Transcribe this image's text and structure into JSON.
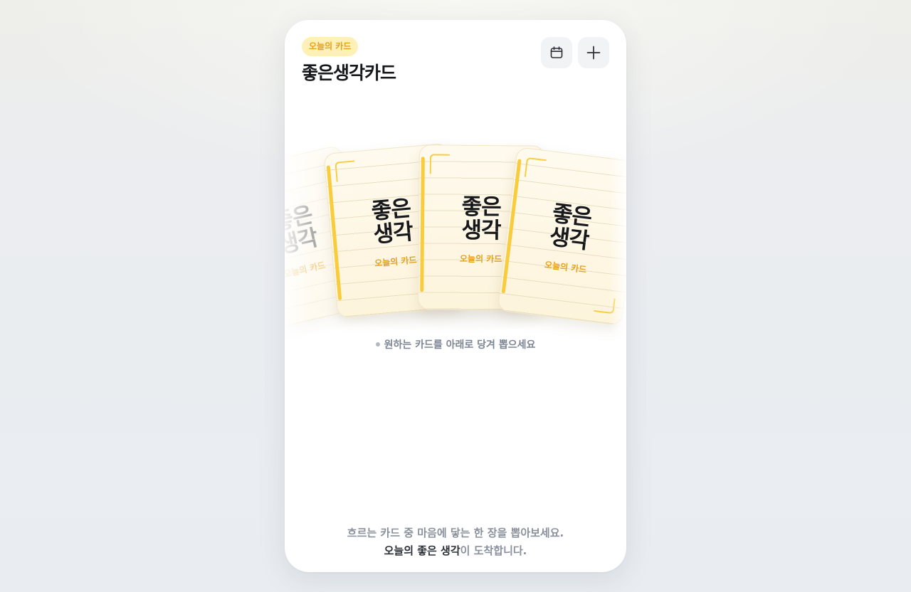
{
  "header": {
    "badge": "오늘의 카드",
    "title": "좋은생각카드",
    "calendar_icon": "calendar-icon",
    "add_icon": "plus-icon"
  },
  "cards": [
    {
      "line1": "좋은",
      "line2": "생각",
      "sub": "오늘의 카드"
    },
    {
      "line1": "좋은",
      "line2": "생각",
      "sub": "오늘의 카드"
    },
    {
      "line1": "좋은",
      "line2": "생각",
      "sub": "오늘의 카드"
    },
    {
      "line1": "좋은",
      "line2": "생각",
      "sub": "오늘의 카드"
    }
  ],
  "hint": "원하는 카드를 아래로 당겨 뽑으세요",
  "footer": {
    "line1": "흐르는 카드 중 마음에 닿는 한 장을 뽑아보세요.",
    "line2_strong": "오늘의 좋은 생각",
    "line2_rest": "이 도착합니다."
  },
  "colors": {
    "accent": "#f8cc3c",
    "badge_bg": "#fff0b8",
    "badge_text": "#e3a21a",
    "title": "#16181c"
  }
}
